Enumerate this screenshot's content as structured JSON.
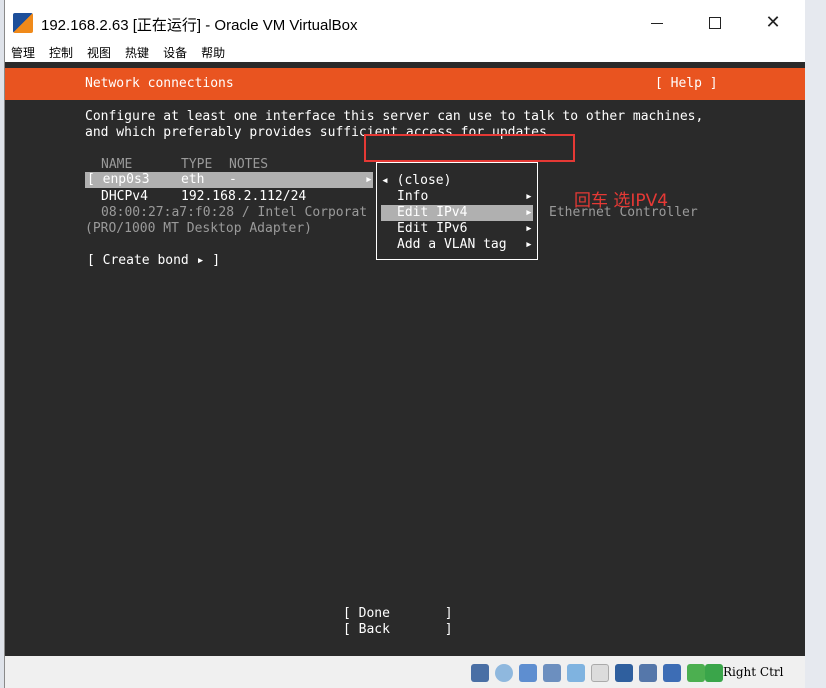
{
  "window": {
    "title": "192.168.2.63 [正在运行] - Oracle VM VirtualBox",
    "controls": {
      "minimize": "—",
      "maximize": "☐",
      "close": "✕"
    }
  },
  "menubar": {
    "items": [
      "管理",
      "控制",
      "视图",
      "热键",
      "设备",
      "帮助"
    ]
  },
  "installer": {
    "header_title": "Network connections",
    "help_label": "[ Help ]",
    "description_line1": "Configure at least one interface this server can use to talk to other machines,",
    "description_line2": "and which preferably provides sufficient access for updates.",
    "columns": {
      "name": "NAME",
      "type": "TYPE",
      "notes": "NOTES"
    },
    "interface": {
      "name": "[ enp0s3",
      "type": "eth",
      "notes": "-",
      "arrow": "▸",
      "dhcp_label": "DHCPv4",
      "ip": "192.168.2.112/24",
      "mac_line": "08:00:27:a7:f0:28 / Intel Corporat",
      "vendor_tail": "Ethernet Controller",
      "adapter_line": "(PRO/1000 MT Desktop Adapter)"
    },
    "create_bond": "[ Create bond ▸ ]",
    "popup_menu": {
      "close": "◂ (close)",
      "items": [
        {
          "label": "Info",
          "arrow": "▸"
        },
        {
          "label": "Edit IPv4",
          "arrow": "▸",
          "selected": true
        },
        {
          "label": "Edit IPv6",
          "arrow": "▸"
        },
        {
          "label": "Add a VLAN tag",
          "arrow": "▸"
        }
      ]
    },
    "buttons": {
      "done": "[ Done       ]",
      "back": "[ Back       ]"
    }
  },
  "annotation": {
    "text": "回车 选IPV4",
    "color": "#e53935"
  },
  "statusbar": {
    "icons": [
      "hard-disk-icon",
      "optical-drive-icon",
      "usb-icon",
      "network-icon",
      "shared-folder-icon",
      "display-icon",
      "screen-icon",
      "capture-icon",
      "virtualization-icon",
      "mouse-integration-icon",
      "arrow-down-icon"
    ],
    "host_key": "Right Ctrl"
  },
  "colors": {
    "accent": "#e95420",
    "screen_bg": "#2a2a2a",
    "highlight": "#b0b0b0"
  }
}
